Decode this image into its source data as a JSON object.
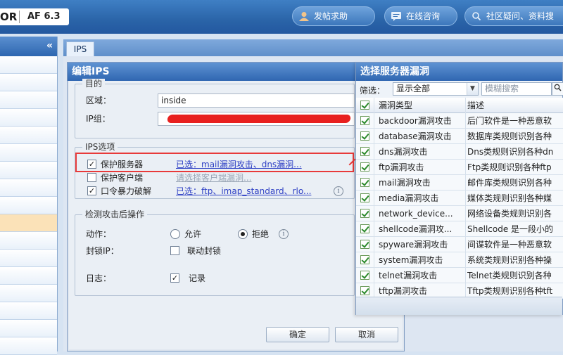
{
  "header": {
    "brand": "OR",
    "version": "AF 6.3",
    "buttons": [
      {
        "label": "发帖求助",
        "icon": "user-icon"
      },
      {
        "label": "在线咨询",
        "icon": "chat-icon"
      },
      {
        "label": "社区疑问、资料搜",
        "icon": "search-icon"
      }
    ]
  },
  "sidebar": {
    "collapse_label": "«"
  },
  "tabs": [
    {
      "label": "IPS"
    }
  ],
  "dialog": {
    "title": "编辑IPS",
    "top_legend": "目的",
    "zone_label": "区域：",
    "zone_value": "inside",
    "ipgroup_label": "IP组：",
    "ips_legend": "IPS选项",
    "options": [
      {
        "label": "保护服务器",
        "checked": true,
        "link": "已选：mail漏洞攻击、dns漏洞..."
      },
      {
        "label": "保护客户端",
        "checked": false,
        "link": "请选择客户端漏洞..."
      },
      {
        "label": "口令暴力破解",
        "checked": true,
        "link": "已选：ftp、imap_standard、rlo..."
      }
    ],
    "after_legend": "检测攻击后操作",
    "action_label": "动作：",
    "allow_label": "允许",
    "deny_label": "拒绝",
    "block_label": "封锁IP：",
    "block_option": "联动封锁",
    "log_label": "日志：",
    "log_option": "记录",
    "ok_label": "确定",
    "cancel_label": "取消"
  },
  "vuln_panel": {
    "title": "选择服务器漏洞",
    "filter_label": "筛选：",
    "filter_value": "显示全部",
    "search_placeholder": "模糊搜索",
    "columns": [
      "漏洞类型",
      "描述"
    ],
    "rows": [
      {
        "name": "backdoor漏洞攻击",
        "desc": "后门软件是一种恶意软"
      },
      {
        "name": "database漏洞攻击",
        "desc": "数据库类规则识别各种"
      },
      {
        "name": "dns漏洞攻击",
        "desc": "Dns类规则识别各种dn"
      },
      {
        "name": "ftp漏洞攻击",
        "desc": "Ftp类规则识别各种ftp"
      },
      {
        "name": "mail漏洞攻击",
        "desc": "邮件库类规则识别各种"
      },
      {
        "name": "media漏洞攻击",
        "desc": "媒体类规则识别各种媒"
      },
      {
        "name": "network_device...",
        "desc": "网络设备类规则识别各"
      },
      {
        "name": "shellcode漏洞攻...",
        "desc": "Shellcode 是一段小的"
      },
      {
        "name": "spyware漏洞攻击",
        "desc": "间谍软件是一种恶意软"
      },
      {
        "name": "system漏洞攻击",
        "desc": "系统类规则识别各种操"
      },
      {
        "name": "telnet漏洞攻击",
        "desc": "Telnet类规则识别各种"
      },
      {
        "name": "tftp漏洞攻击",
        "desc": "Tftp类规则识别各种tft"
      }
    ]
  },
  "colors": {
    "header_blue": "#2a64a8",
    "highlight_red": "#e83a3a",
    "link_blue": "#2d3fc4"
  }
}
